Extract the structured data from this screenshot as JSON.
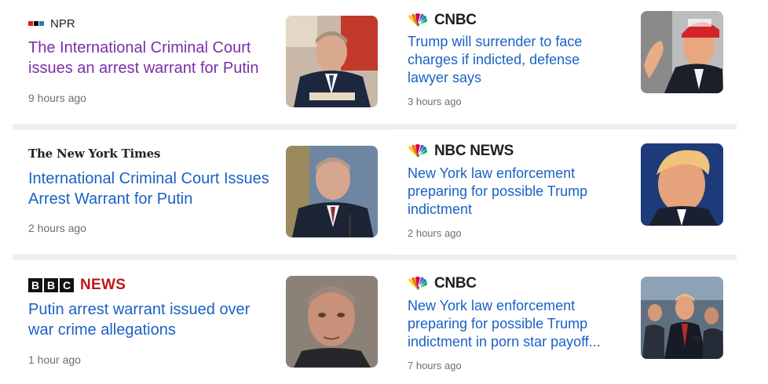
{
  "left_cards": [
    {
      "source": "NPR",
      "headline": "The International Criminal Court issues an arrest warrant for Putin",
      "time": "9 hours ago",
      "thumb_icon": "putin-photo"
    },
    {
      "source": "The New York Times",
      "headline": "International Criminal Court Issues Arrest Warrant for Putin",
      "time": "2 hours ago",
      "thumb_icon": "putin-photo"
    },
    {
      "source_box": [
        "B",
        "B",
        "C"
      ],
      "source_suffix": "NEWS",
      "headline": "Putin arrest warrant issued over war crime allegations",
      "time": "1 hour ago",
      "thumb_icon": "putin-photo"
    }
  ],
  "right_cards": [
    {
      "source": "CNBC",
      "headline": "Trump will surrender to face charges if indicted, defense lawyer says",
      "time": "3 hours ago",
      "thumb_icon": "trump-photo"
    },
    {
      "source": "NBC NEWS",
      "headline": "New York law enforcement preparing for possible Trump indictment",
      "time": "2 hours ago",
      "thumb_icon": "trump-photo"
    },
    {
      "source": "CNBC",
      "headline": "New York law enforcement preparing for possible Trump indictment in porn star payoff...",
      "time": "7 hours ago",
      "thumb_icon": "trump-photo"
    }
  ],
  "colors": {
    "link": "#1a61c6",
    "visited": "#7b2fa8",
    "time": "#6b6f73",
    "bbc_red": "#bb1919",
    "separator": "#eceeef"
  }
}
